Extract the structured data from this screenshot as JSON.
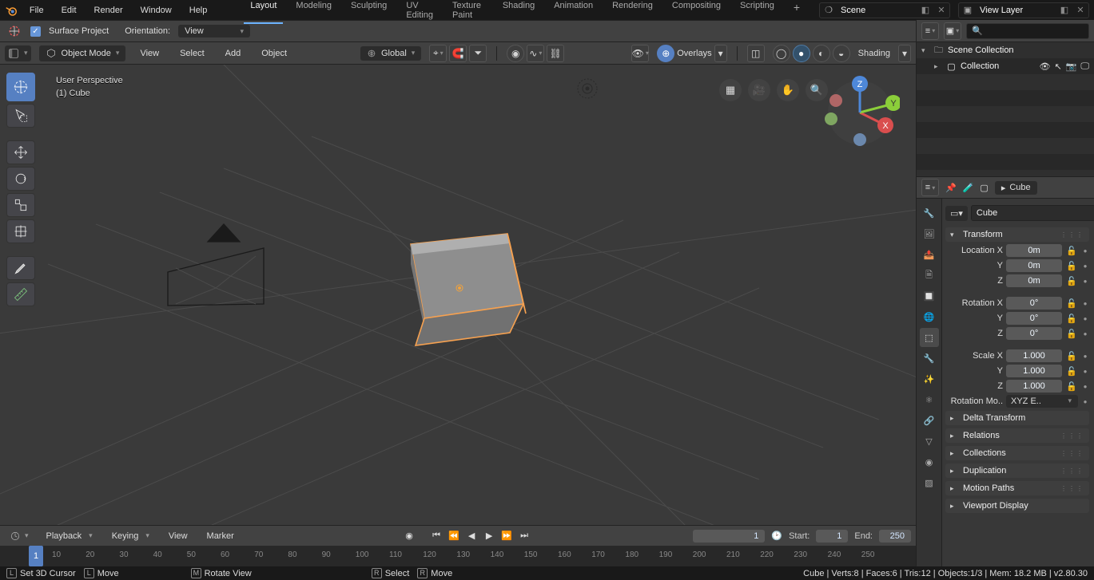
{
  "topbar": {
    "menus": [
      "File",
      "Edit",
      "Render",
      "Window",
      "Help"
    ],
    "tabs": [
      "Layout",
      "Modeling",
      "Sculpting",
      "UV Editing",
      "Texture Paint",
      "Shading",
      "Animation",
      "Rendering",
      "Compositing",
      "Scripting"
    ],
    "active_tab": 0,
    "scene_label": "Scene",
    "viewlayer_label": "View Layer"
  },
  "secbar": {
    "chk_label": "Surface Project",
    "orientation_label": "Orientation:",
    "orientation_value": "View"
  },
  "viewport_header": {
    "mode": "Object Mode",
    "menus": [
      "View",
      "Select",
      "Add",
      "Object"
    ],
    "transform_orient": "Global",
    "overlays_label": "Overlays",
    "shading_label": "Shading"
  },
  "viewport": {
    "overlay_line1": "User Perspective",
    "overlay_line2": "(1) Cube"
  },
  "outliner": {
    "search_placeholder": "",
    "root": "Scene Collection",
    "collection": "Collection"
  },
  "properties": {
    "context_name": "Cube",
    "name_value": "Cube",
    "sections": {
      "transform": "Transform",
      "delta": "Delta Transform",
      "relations": "Relations",
      "collections": "Collections",
      "duplication": "Duplication",
      "motion": "Motion Paths",
      "viewport": "Viewport Display"
    },
    "rows": [
      {
        "k": "Location X",
        "v": "0m"
      },
      {
        "k": "Y",
        "v": "0m"
      },
      {
        "k": "Z",
        "v": "0m"
      },
      {
        "k": "Rotation X",
        "v": "0°"
      },
      {
        "k": "Y",
        "v": "0°"
      },
      {
        "k": "Z",
        "v": "0°"
      },
      {
        "k": "Scale X",
        "v": "1.000"
      },
      {
        "k": "Y",
        "v": "1.000"
      },
      {
        "k": "Z",
        "v": "1.000"
      }
    ],
    "rotmode_label": "Rotation Mo..",
    "rotmode_value": "XYZ E.."
  },
  "timebar": {
    "menus": [
      "Playback",
      "Keying",
      "View",
      "Marker"
    ],
    "current": "1",
    "start_label": "Start:",
    "start": "1",
    "end_label": "End:",
    "end": "250"
  },
  "timeline": {
    "current": 1,
    "ticks": [
      10,
      20,
      30,
      40,
      50,
      60,
      70,
      80,
      90,
      100,
      110,
      120,
      130,
      140,
      150,
      160,
      170,
      180,
      190,
      200,
      210,
      220,
      230,
      240,
      250
    ]
  },
  "status": {
    "actions": [
      "Set 3D Cursor",
      "Move",
      "Rotate View",
      "Select",
      "Move"
    ],
    "right": "Cube | Verts:8 | Faces:6 | Tris:12 | Objects:1/3 | Mem: 18.2 MB | v2.80.30"
  }
}
